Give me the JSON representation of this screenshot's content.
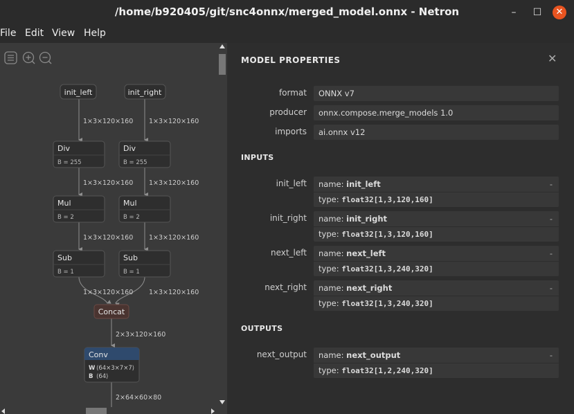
{
  "window": {
    "title": "/home/b920405/git/snc4onnx/merged_model.onnx - Netron",
    "minimize": "–",
    "maximize": "☐",
    "close": "✕"
  },
  "menu": [
    "File",
    "Edit",
    "View",
    "Help"
  ],
  "graph": {
    "inputs": [
      {
        "label": "init_left"
      },
      {
        "label": "init_right"
      }
    ],
    "edges": {
      "in_to_div": "1×3×120×160",
      "div_to_mul": "1×3×120×160",
      "mul_to_sub": "1×3×120×160",
      "sub_to_concat": "1×3×120×160",
      "concat_to_conv": "2×3×120×160",
      "conv_out": "2×64×60×80"
    },
    "columns": [
      {
        "div": {
          "op": "Div",
          "attr": "B = 255"
        },
        "mul": {
          "op": "Mul",
          "attr": "B = 2"
        },
        "sub": {
          "op": "Sub",
          "attr": "B = 1"
        }
      },
      {
        "div": {
          "op": "Div",
          "attr": "B = 255"
        },
        "mul": {
          "op": "Mul",
          "attr": "B = 2"
        },
        "sub": {
          "op": "Sub",
          "attr": "B = 1"
        }
      }
    ],
    "concat": {
      "op": "Concat"
    },
    "conv": {
      "op": "Conv",
      "w_key": "W",
      "w_val": "⟨64×3×7×7⟩",
      "b_key": "B",
      "b_val": "⟨64⟩"
    },
    "colors": {
      "background": "#3a3a3a",
      "node": "#2e2e2e",
      "edge": "#8f8f8f",
      "concat": "#4a3430",
      "conv_header": "#2f4a6d"
    }
  },
  "props": {
    "title": "MODEL PROPERTIES",
    "close": "✕",
    "model": [
      {
        "label": "format",
        "value": "ONNX v7"
      },
      {
        "label": "producer",
        "value": "onnx.compose.merge_models 1.0"
      },
      {
        "label": "imports",
        "value": "ai.onnx v12"
      }
    ],
    "inputs_heading": "INPUTS",
    "inputs": [
      {
        "label": "init_left",
        "name_key": "name:",
        "name": "init_left",
        "type_key": "type:",
        "type": "float32[1,3,120,160]",
        "dash": "-"
      },
      {
        "label": "init_right",
        "name_key": "name:",
        "name": "init_right",
        "type_key": "type:",
        "type": "float32[1,3,120,160]",
        "dash": "-"
      },
      {
        "label": "next_left",
        "name_key": "name:",
        "name": "next_left",
        "type_key": "type:",
        "type": "float32[1,3,240,320]",
        "dash": "-"
      },
      {
        "label": "next_right",
        "name_key": "name:",
        "name": "next_right",
        "type_key": "type:",
        "type": "float32[1,3,240,320]",
        "dash": "-"
      }
    ],
    "outputs_heading": "OUTPUTS",
    "outputs": [
      {
        "label": "next_output",
        "name_key": "name:",
        "name": "next_output",
        "type_key": "type:",
        "type": "float32[1,2,240,320]",
        "dash": "-"
      }
    ]
  }
}
